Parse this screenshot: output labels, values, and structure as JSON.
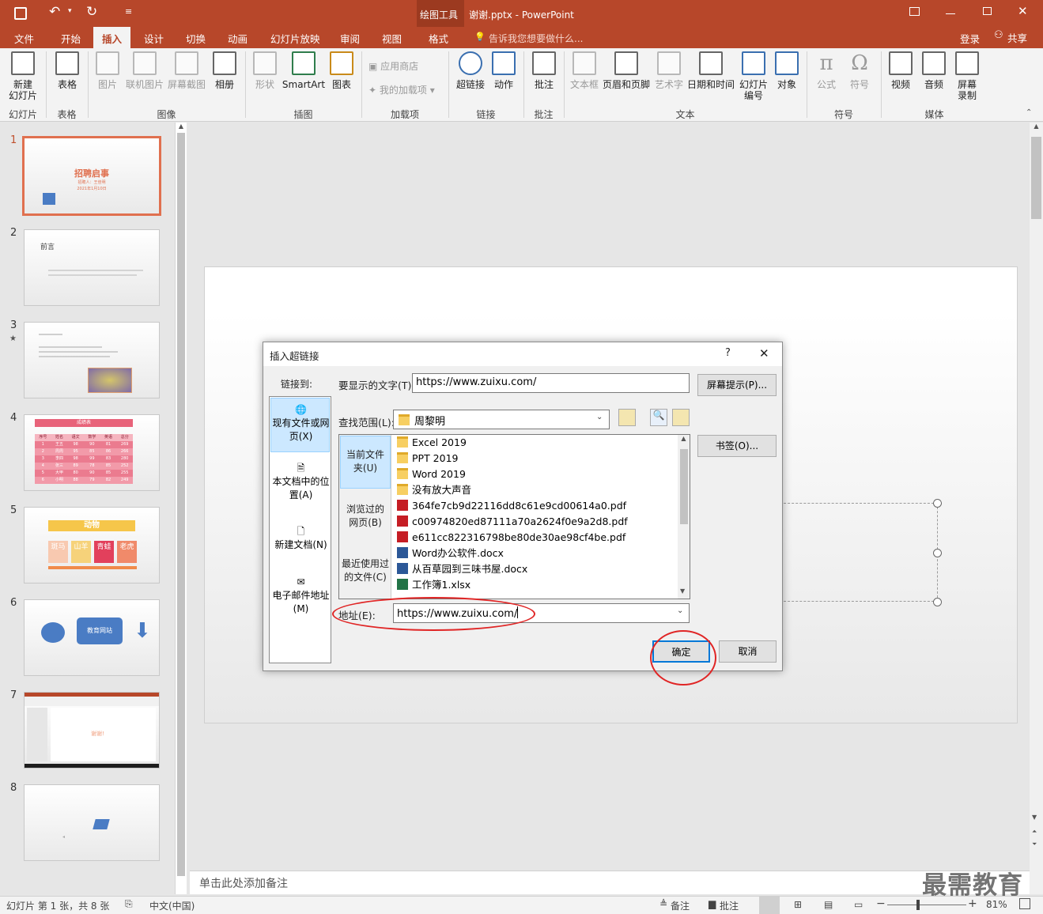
{
  "titlebar": {
    "context_tab": "绘图工具",
    "doc_title": "谢谢.pptx - PowerPoint"
  },
  "menubar": {
    "tabs": [
      "文件",
      "开始",
      "插入",
      "设计",
      "切换",
      "动画",
      "幻灯片放映",
      "审阅",
      "视图",
      "格式"
    ],
    "active_tab": "插入",
    "tell_me": "告诉我您想要做什么...",
    "login": "登录",
    "share": "共享"
  },
  "ribbon": {
    "buttons": {
      "new_slide": "新建\n幻灯片",
      "table": "表格",
      "picture": "图片",
      "online_picture": "联机图片",
      "screenshot": "屏幕截图",
      "album": "相册",
      "shapes": "形状",
      "smartart": "SmartArt",
      "chart": "图表",
      "store": "应用商店",
      "my_addins": "我的加载项",
      "hyperlink": "超链接",
      "action": "动作",
      "comment": "批注",
      "textbox": "文本框",
      "header_footer": "页眉和页脚",
      "wordart": "艺术字",
      "datetime": "日期和时间",
      "slide_number": "幻灯片\n编号",
      "object": "对象",
      "equation": "公式",
      "symbol": "符号",
      "video": "视频",
      "audio": "音频",
      "screen_record": "屏幕\n录制"
    },
    "groups": {
      "slides": "幻灯片",
      "tables": "表格",
      "images": "图像",
      "illustrations": "插图",
      "addins": "加载项",
      "links": "链接",
      "comments": "批注",
      "text": "文本",
      "symbols": "符号",
      "media": "媒体"
    }
  },
  "thumbnails": {
    "numbers": [
      "1",
      "2",
      "3",
      "4",
      "5",
      "6",
      "7",
      "8"
    ],
    "s1": {
      "title": "招聘启事",
      "sub1": "招聘人：王佳明",
      "sub2": "2021年1月10日"
    },
    "s2": {
      "title": "前言"
    },
    "s4": {
      "title": "成绩表",
      "headers": [
        "序号",
        "姓名",
        "语文",
        "数学",
        "英语",
        "总分"
      ],
      "rows": [
        [
          "1",
          "王五",
          "98",
          "90",
          "81",
          "269"
        ],
        [
          "2",
          "周周",
          "95",
          "85",
          "86",
          "266"
        ],
        [
          "3",
          "李四",
          "98",
          "99",
          "83",
          "280"
        ],
        [
          "4",
          "张三",
          "89",
          "78",
          "85",
          "252"
        ],
        [
          "5",
          "大甲",
          "80",
          "90",
          "85",
          "255"
        ],
        [
          "6",
          "小明",
          "88",
          "79",
          "82",
          "249"
        ]
      ]
    },
    "s5": {
      "title": "动物",
      "chars": [
        "斑马",
        "山羊",
        "青蛙",
        "老虎"
      ]
    },
    "s6": {
      "label": "教育网站"
    },
    "s7": {
      "label": "谢谢!"
    }
  },
  "notes": "单击此处添加备注",
  "dialog": {
    "title": "插入超链接",
    "help": "?",
    "close": "✕",
    "link_to": "链接到:",
    "nav": [
      "现有文件或网页(X)",
      "本文档中的位置(A)",
      "新建文档(N)",
      "电子邮件地址(M)"
    ],
    "display_text_label": "要显示的文字(T):",
    "display_text": "https://www.zuixu.com/",
    "screen_tip": "屏幕提示(P)...",
    "look_in_label": "查找范围(L):",
    "look_in": "周黎明",
    "subnav": [
      "当前文件夹(U)",
      "浏览过的网页(B)",
      "最近使用过的文件(C)"
    ],
    "files": [
      {
        "name": "Excel 2019",
        "type": "folder"
      },
      {
        "name": "PPT 2019",
        "type": "folder"
      },
      {
        "name": "Word 2019",
        "type": "folder"
      },
      {
        "name": "没有放大声音",
        "type": "folder"
      },
      {
        "name": "364fe7cb9d22116dd8c61e9cd00614a0.pdf",
        "type": "pdf"
      },
      {
        "name": "c00974820ed87111a70a2624f0e9a2d8.pdf",
        "type": "pdf"
      },
      {
        "name": "e611cc822316798be80de30ae98cf4be.pdf",
        "type": "pdf"
      },
      {
        "name": "Word办公软件.docx",
        "type": "docx"
      },
      {
        "name": "从百草园到三味书屋.docx",
        "type": "docx"
      },
      {
        "name": "工作簿1.xlsx",
        "type": "xlsx"
      }
    ],
    "bookmark": "书签(O)...",
    "address_label": "地址(E):",
    "address": "https://www.zuixu.com/",
    "ok": "确定",
    "cancel": "取消"
  },
  "status": {
    "slide_info": "幻灯片 第 1 张，共 8 张",
    "language": "中文(中国)",
    "notes": "备注",
    "comments": "批注",
    "zoom": "81%"
  },
  "watermark": "最需教育",
  "colors": {
    "accent": "#b7472a",
    "annotation": "#e02525"
  }
}
